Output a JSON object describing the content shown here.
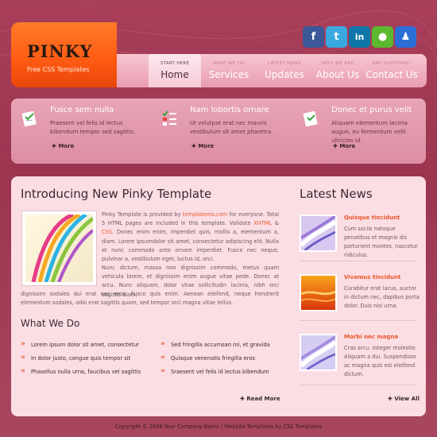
{
  "header": {
    "logo_title": "PINKY",
    "logo_subtitle": "Free CSS Templates"
  },
  "nav": [
    {
      "small": "START HERE",
      "big": "Home",
      "active": true
    },
    {
      "small": "WHAT WE DO",
      "big": "Services",
      "active": false
    },
    {
      "small": "LATEST NEWS",
      "big": "Updates",
      "active": false
    },
    {
      "small": "WHO WE ARE",
      "big": "About Us",
      "active": false
    },
    {
      "small": "ANY QUESTION?",
      "big": "Contact Us",
      "active": false
    }
  ],
  "social": [
    {
      "icon": "facebook-icon",
      "glyph": "f",
      "color": "#3b5998"
    },
    {
      "icon": "twitter-icon",
      "glyph": "t",
      "color": "#39a9e0"
    },
    {
      "icon": "linkedin-icon",
      "glyph": "in",
      "color": "#0e76a8"
    },
    {
      "icon": "chat-icon",
      "glyph": "●",
      "color": "#5cb82e"
    },
    {
      "icon": "messenger-icon",
      "glyph": "♟",
      "color": "#2b6fd6"
    }
  ],
  "features": [
    {
      "title": "Fusce sem nulla",
      "text": "Praesent vel felis id lectus bibendum tempor sed sagittis.",
      "more": "More"
    },
    {
      "title": "Nam lobortis ornare",
      "text": "Ut volutpat erat nec mauris vestibulum sit amet pharetra.",
      "more": "More"
    },
    {
      "title": "Donec et purus velit",
      "text": "Aliquam elementum lacinia augue, eu fermentum velit ultricies id.",
      "more": "More"
    }
  ],
  "main": {
    "title": "Introducing New Pinky Template",
    "p1_a": "Pinky Template is provided by ",
    "p1_link": "templatemo.com",
    "p1_b": " for everyone. Total 5 HTML pages are included in this template. Validate ",
    "p1_xhtml": "XHTML",
    "p1_and": " & ",
    "p1_css": "CSS",
    "p1_c": ". Donec enim enim, imperdiet quis, mollis a, elementum a, diam. Lorem ipsumdolor sit amet, consectetur adipiscing elit. Nulla et nunc commodo ante ornare imperdiet. Fusce nec neque, pulvinar a, vestibulum eget, luctus id, orci.",
    "p2_a": "Nunc dictum, massa non dignissim commodo, metus quam vehicula lorem, et dignissim enim augue vitae pede. Donec at arcu. Nunc aliquam, dolor vitae sollicitudin lacinia, nibh orci sagittis diam,",
    "p2_b": "dignissim sodales dui erat nec eros. Fusce quis enim. Aenean eleifend, neque hendrerit elementum sodales, odio erat sagittis quam, sed tempor orci magna vitae tellus.",
    "what_title": "What We Do",
    "list_left": [
      "Lorem ipsum dolor sit amet, consectetur",
      "In dolor justo, congue quis tempor sit",
      "Phasellus nulla urna, faucibus vel sagittis"
    ],
    "list_right": [
      "Sed fringilla accumsan mi, et gravida",
      "Quisque venenatis fringilla eros",
      "Sraesent vel felis id lectus bibendum"
    ],
    "read_more": "Read More"
  },
  "news": {
    "title": "Latest News",
    "items": [
      {
        "title": "Quisque tincidunt",
        "text": "Cum sociis natoque penatibus et magnis dis parturient montes, nascetur ridiculus."
      },
      {
        "title": "Vivamus tincidunt",
        "text": "Curabitur erat lacus, auctor in dictum nec, dapibus porta dolor. Duis nisi urna."
      },
      {
        "title": "Morbi nec magna",
        "text": "Cras arcu. Integer molestie. Aliquam a dui. Suspendisse ac magna quis est eleifend dictum."
      }
    ],
    "view_all": "View All"
  },
  "footer": {
    "text": "Copyright © 2048 Your Company Name | Website Templates by CSS Templates"
  }
}
